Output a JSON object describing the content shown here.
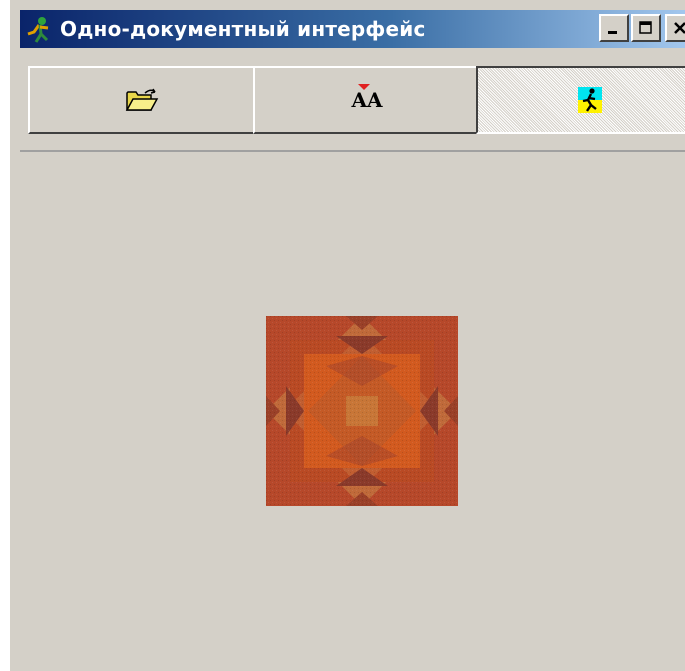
{
  "window": {
    "title": "Одно-документный интерфейс",
    "app_icon": "running-figure-icon",
    "caption_buttons": [
      "minimize",
      "maximize",
      "close"
    ],
    "title_gradient": [
      "#0a246a",
      "#a6caf0"
    ],
    "face_color": "#d4d0c8"
  },
  "toolbar": {
    "buttons": [
      {
        "name": "open",
        "icon": "open-folder-icon",
        "pressed": false
      },
      {
        "name": "font",
        "icon": "font-icon",
        "text": "AA",
        "pressed": false
      },
      {
        "name": "run",
        "icon": "running-man-icon",
        "pressed": true
      }
    ]
  },
  "content": {
    "image": "quilt-pattern-image",
    "image_colors": [
      "#b6482a",
      "#d25a1f",
      "#8a3a2a",
      "#c9803e"
    ]
  }
}
